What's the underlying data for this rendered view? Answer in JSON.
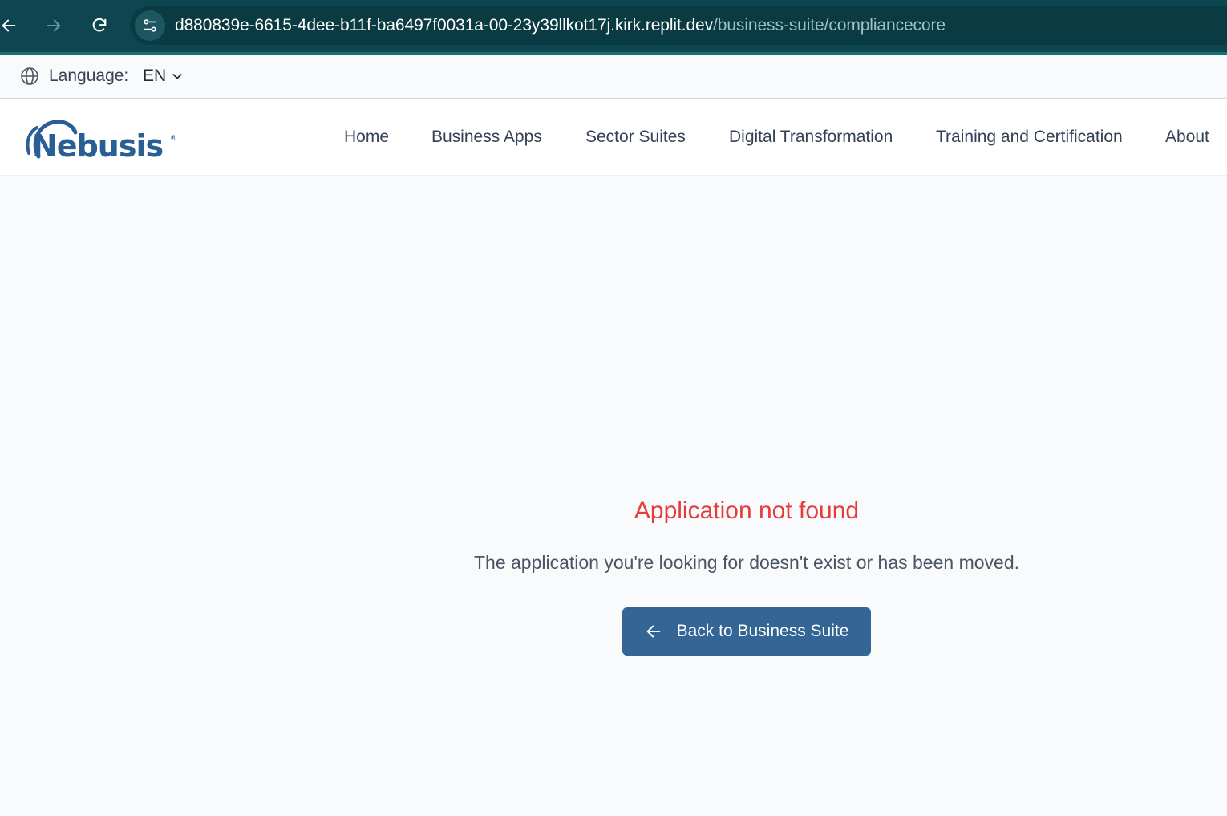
{
  "browser": {
    "url_host": "d880839e-6615-4dee-b11f-ba6497f0031a-00-23y39llkot17j.kirk.replit.dev",
    "url_path": "/business-suite/compliancecore",
    "icons": [
      "back-arrow-icon",
      "forward-arrow-icon",
      "reload-icon",
      "site-info-icon"
    ]
  },
  "language_bar": {
    "label": "Language:",
    "selected": "EN",
    "icons": [
      "globe-icon",
      "chevron-down-icon"
    ]
  },
  "header": {
    "logo_text": "Nebusis",
    "nav": [
      {
        "label": "Home"
      },
      {
        "label": "Business Apps"
      },
      {
        "label": "Sector Suites"
      },
      {
        "label": "Digital Transformation"
      },
      {
        "label": "Training and Certification"
      },
      {
        "label": "About"
      }
    ]
  },
  "main": {
    "title": "Application not found",
    "message": "The application you're looking for doesn't exist or has been moved.",
    "back_button_label": "Back to Business Suite",
    "back_button_icon": "arrow-left-icon"
  },
  "colors": {
    "browser_bar": "#0d4650",
    "error_title": "#e63b3b",
    "button": "#336595",
    "brand": "#2a5f95"
  }
}
